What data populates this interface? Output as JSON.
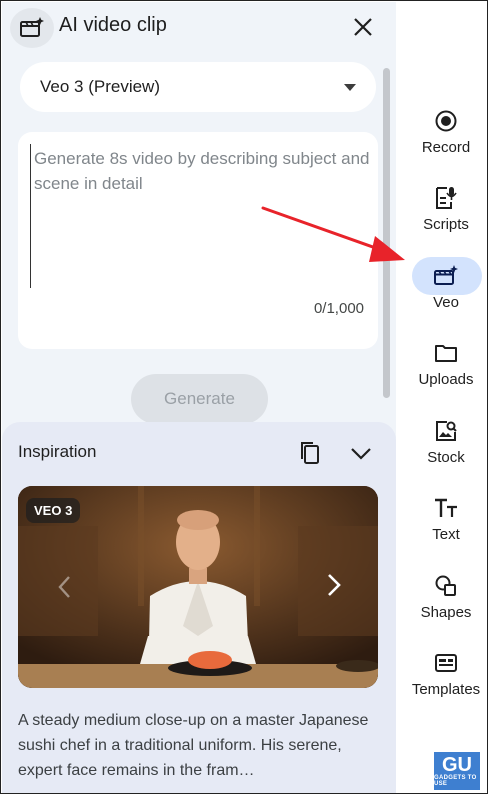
{
  "header": {
    "title": "AI video clip",
    "icon": "video-sparkle-icon",
    "close_icon": "close-icon"
  },
  "model_select": {
    "value": "Veo 3 (Preview)"
  },
  "prompt": {
    "placeholder": "Generate 8s video by describing subject and scene in detail",
    "value": "",
    "counter": "0/1,000"
  },
  "generate_label": "Generate",
  "inspiration": {
    "title": "Inspiration",
    "badge": "VEO 3",
    "description": "A steady medium close-up on a master Japanese sushi chef in a traditional uniform. His serene, expert face remains in the fram…"
  },
  "rail": {
    "items": [
      {
        "label": "Record",
        "icon": "record-icon"
      },
      {
        "label": "Scripts",
        "icon": "script-mic-icon"
      },
      {
        "label": "Veo",
        "icon": "clapperboard-sparkle-icon",
        "active": true
      },
      {
        "label": "Uploads",
        "icon": "folder-icon"
      },
      {
        "label": "Stock",
        "icon": "stock-image-search-icon"
      },
      {
        "label": "Text",
        "icon": "text-tt-icon"
      },
      {
        "label": "Shapes",
        "icon": "shapes-icon"
      },
      {
        "label": "Templates",
        "icon": "templates-icon"
      }
    ]
  },
  "watermark": {
    "big": "GU",
    "small": "GADGETS TO USE"
  },
  "colors": {
    "panel_bg": "#f0f4f9",
    "active_pill": "#d3e3fd",
    "annotation_arrow": "#e8232a",
    "watermark_bg": "#3e7fd0"
  }
}
